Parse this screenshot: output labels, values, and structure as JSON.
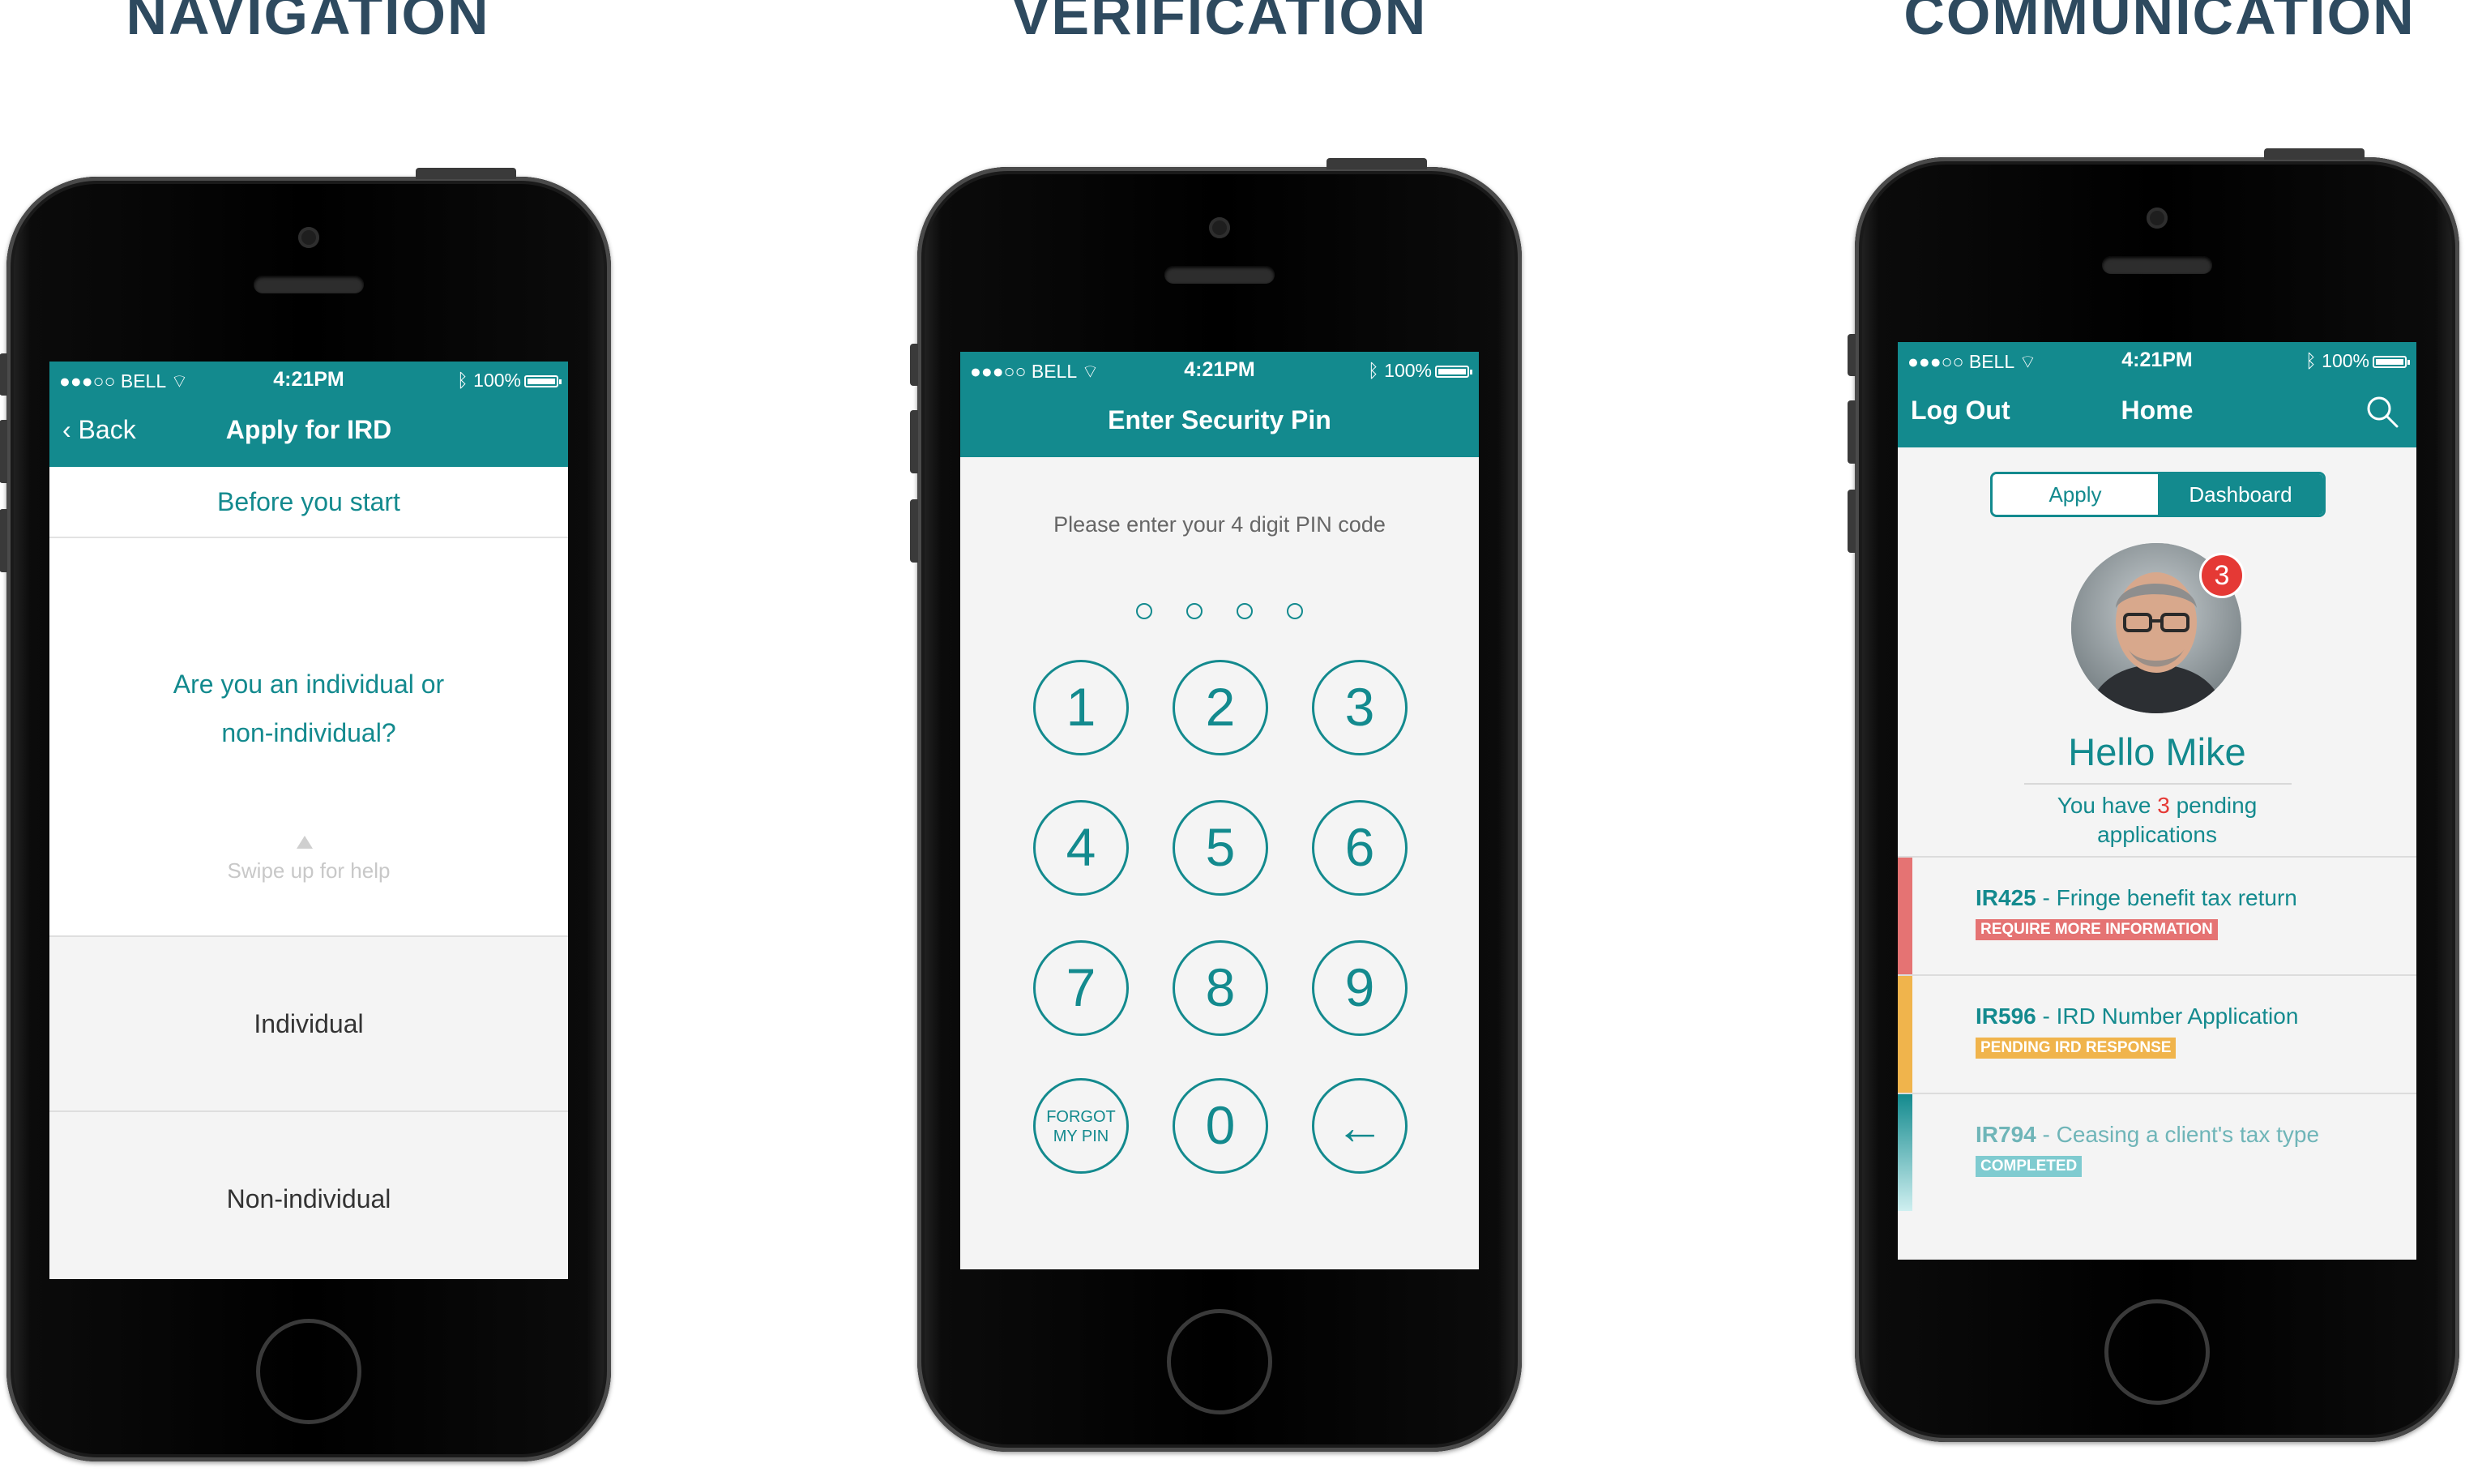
{
  "titles": {
    "navigation": "NAVIGATION",
    "verification": "VERIFICATION",
    "communication": "COMMUNICATION"
  },
  "status_bar": {
    "carrier": "●●●○○ BELL",
    "time": "4:21PM",
    "battery": "100%"
  },
  "colors": {
    "teal": "#138a8e",
    "red": "#e53935",
    "orange": "#f0b44c",
    "completed": "#7fcbd0"
  },
  "phone1": {
    "back_label": "Back",
    "title": "Apply for IRD",
    "subheading": "Before you start",
    "question_line1": "Are you an individual or",
    "question_line2": "non-individual?",
    "swipe_hint": "Swipe up for help",
    "option1": "Individual",
    "option2": "Non-individual"
  },
  "phone2": {
    "title": "Enter Security Pin",
    "prompt": "Please enter your 4 digit PIN code",
    "keys": [
      "1",
      "2",
      "3",
      "4",
      "5",
      "6",
      "7",
      "8",
      "9",
      "0"
    ],
    "forgot_line1": "FORGOT",
    "forgot_line2": "MY PIN",
    "backspace": "←"
  },
  "phone3": {
    "logout_label": "Log Out",
    "title": "Home",
    "tab_apply": "Apply",
    "tab_dashboard": "Dashboard",
    "notification_count": "3",
    "greeting": "Hello Mike",
    "pending_pre": "You have",
    "pending_count": "3",
    "pending_post": "pending",
    "pending_line2": "applications",
    "applications": [
      {
        "code": "IR425",
        "sep": " - ",
        "name": "Fringe benefit tax return",
        "status": "REQUIRE MORE INFORMATION"
      },
      {
        "code": "IR596",
        "sep": " - ",
        "name": "IRD Number Application",
        "status": "PENDING IRD RESPONSE"
      },
      {
        "code": "IR794",
        "sep": " - ",
        "name": "Ceasing a client's tax type",
        "status": "COMPLETED"
      }
    ]
  }
}
